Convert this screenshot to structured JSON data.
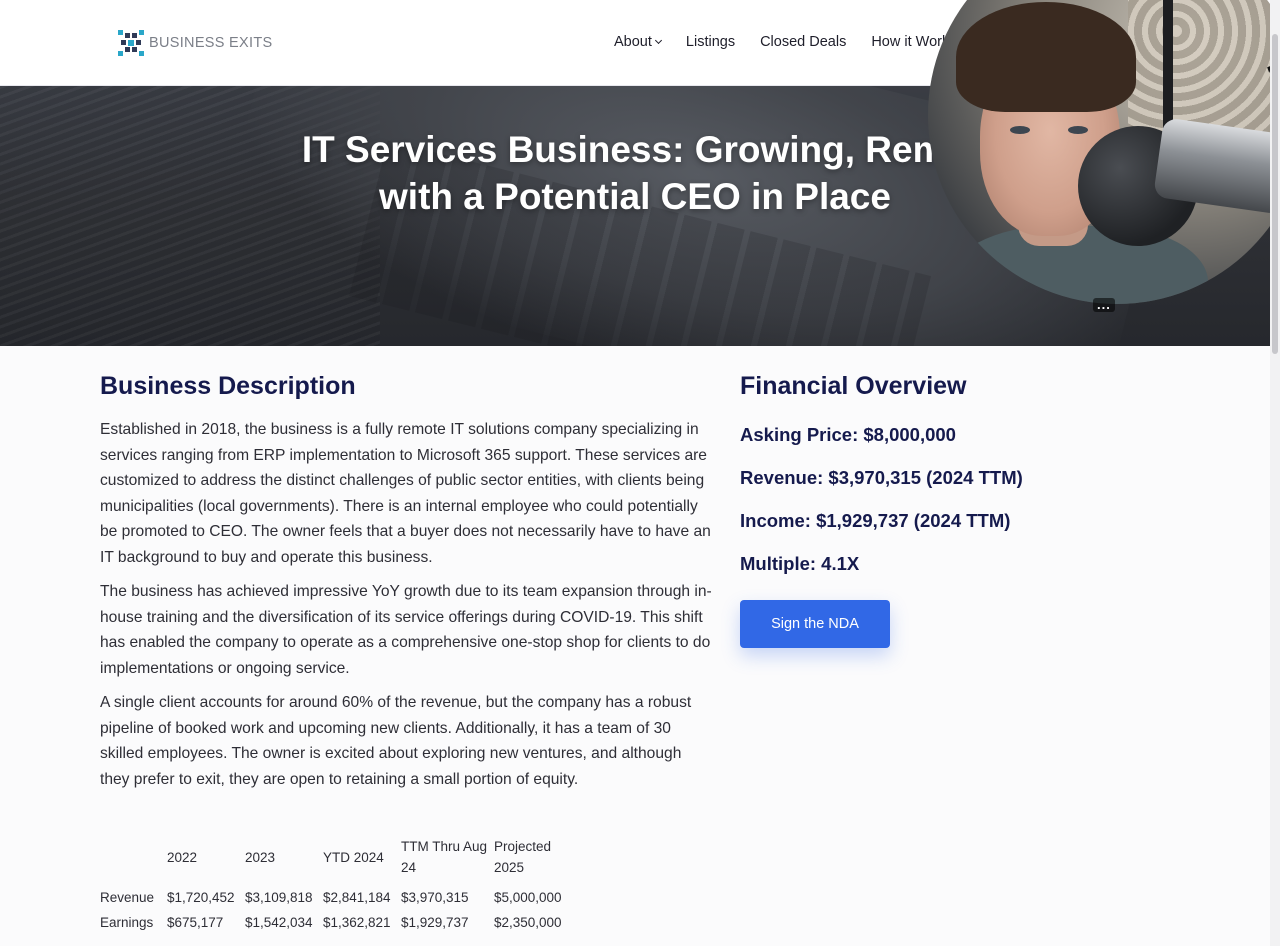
{
  "header": {
    "logo_text": "BUSINESS EXITS",
    "nav": [
      {
        "label": "About",
        "has_dropdown": true
      },
      {
        "label": "Listings"
      },
      {
        "label": "Closed Deals"
      },
      {
        "label": "How it Work"
      }
    ]
  },
  "hero": {
    "title_line1": "IT Services Business: Growing, Remo",
    "title_line2": "with a Potential CEO in Place"
  },
  "overlay": {
    "menu_label": "..."
  },
  "description": {
    "heading": "Business Description",
    "paragraphs": [
      "Established in 2018, the business is a fully remote IT solutions company specializing in services ranging from ERP implementation to Microsoft 365 support. These services are customized to address the distinct challenges of public sector entities, with clients being municipalities (local governments). There is an internal employee who could potentially be promoted to CEO. The owner feels that a buyer does not necessarily have to have an IT background to buy and operate this business.",
      "The business has achieved impressive YoY growth due to its team expansion through in-house training and the diversification of its service offerings during COVID-19. This shift has enabled the company to operate as a comprehensive one-stop shop for clients to do implementations or ongoing service.",
      "A single client accounts for around 60% of the revenue, but the company has a robust pipeline of booked work and upcoming new clients. Additionally, it has a team of 30 skilled employees. The owner is excited about exploring new ventures, and although they prefer to exit, they are open to retaining a small portion of equity."
    ]
  },
  "financial": {
    "heading": "Financial Overview",
    "asking_price": "Asking Price: $8,000,000",
    "revenue": "Revenue: $3,970,315 (2024 TTM)",
    "income": "Income: $1,929,737 (2024 TTM)",
    "multiple": "Multiple: 4.1X",
    "nda_button": "Sign the NDA"
  },
  "table": {
    "headers": [
      "",
      "2022",
      "2023",
      "YTD 2024",
      "TTM Thru Aug 24",
      "Projected 2025"
    ],
    "rows": [
      [
        "Revenue",
        "$1,720,452",
        "$3,109,818",
        "$2,841,184",
        "$3,970,315",
        "$5,000,000"
      ],
      [
        "Earnings",
        "$675,177",
        "$1,542,034",
        "$1,362,821",
        "$1,929,737",
        "$2,350,000"
      ]
    ]
  },
  "colors": {
    "heading": "#151a4d",
    "button": "#3168e6",
    "logo_accent": "#2aa7c9"
  }
}
